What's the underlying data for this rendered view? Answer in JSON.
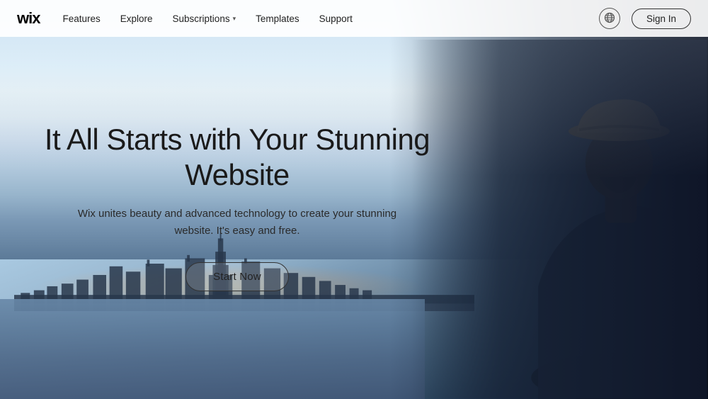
{
  "navbar": {
    "logo": "wix",
    "nav_items": [
      {
        "label": "Features",
        "has_dropdown": false
      },
      {
        "label": "Explore",
        "has_dropdown": false
      },
      {
        "label": "Subscriptions",
        "has_dropdown": true
      },
      {
        "label": "Templates",
        "has_dropdown": false
      },
      {
        "label": "Support",
        "has_dropdown": false
      }
    ],
    "globe_icon": "🌐",
    "sign_in_label": "Sign In"
  },
  "hero": {
    "title": "It All Starts with Your Stunning Website",
    "subtitle": "Wix unites beauty and advanced technology to create your stunning website. It's easy and free.",
    "cta_label": "Start Now"
  }
}
